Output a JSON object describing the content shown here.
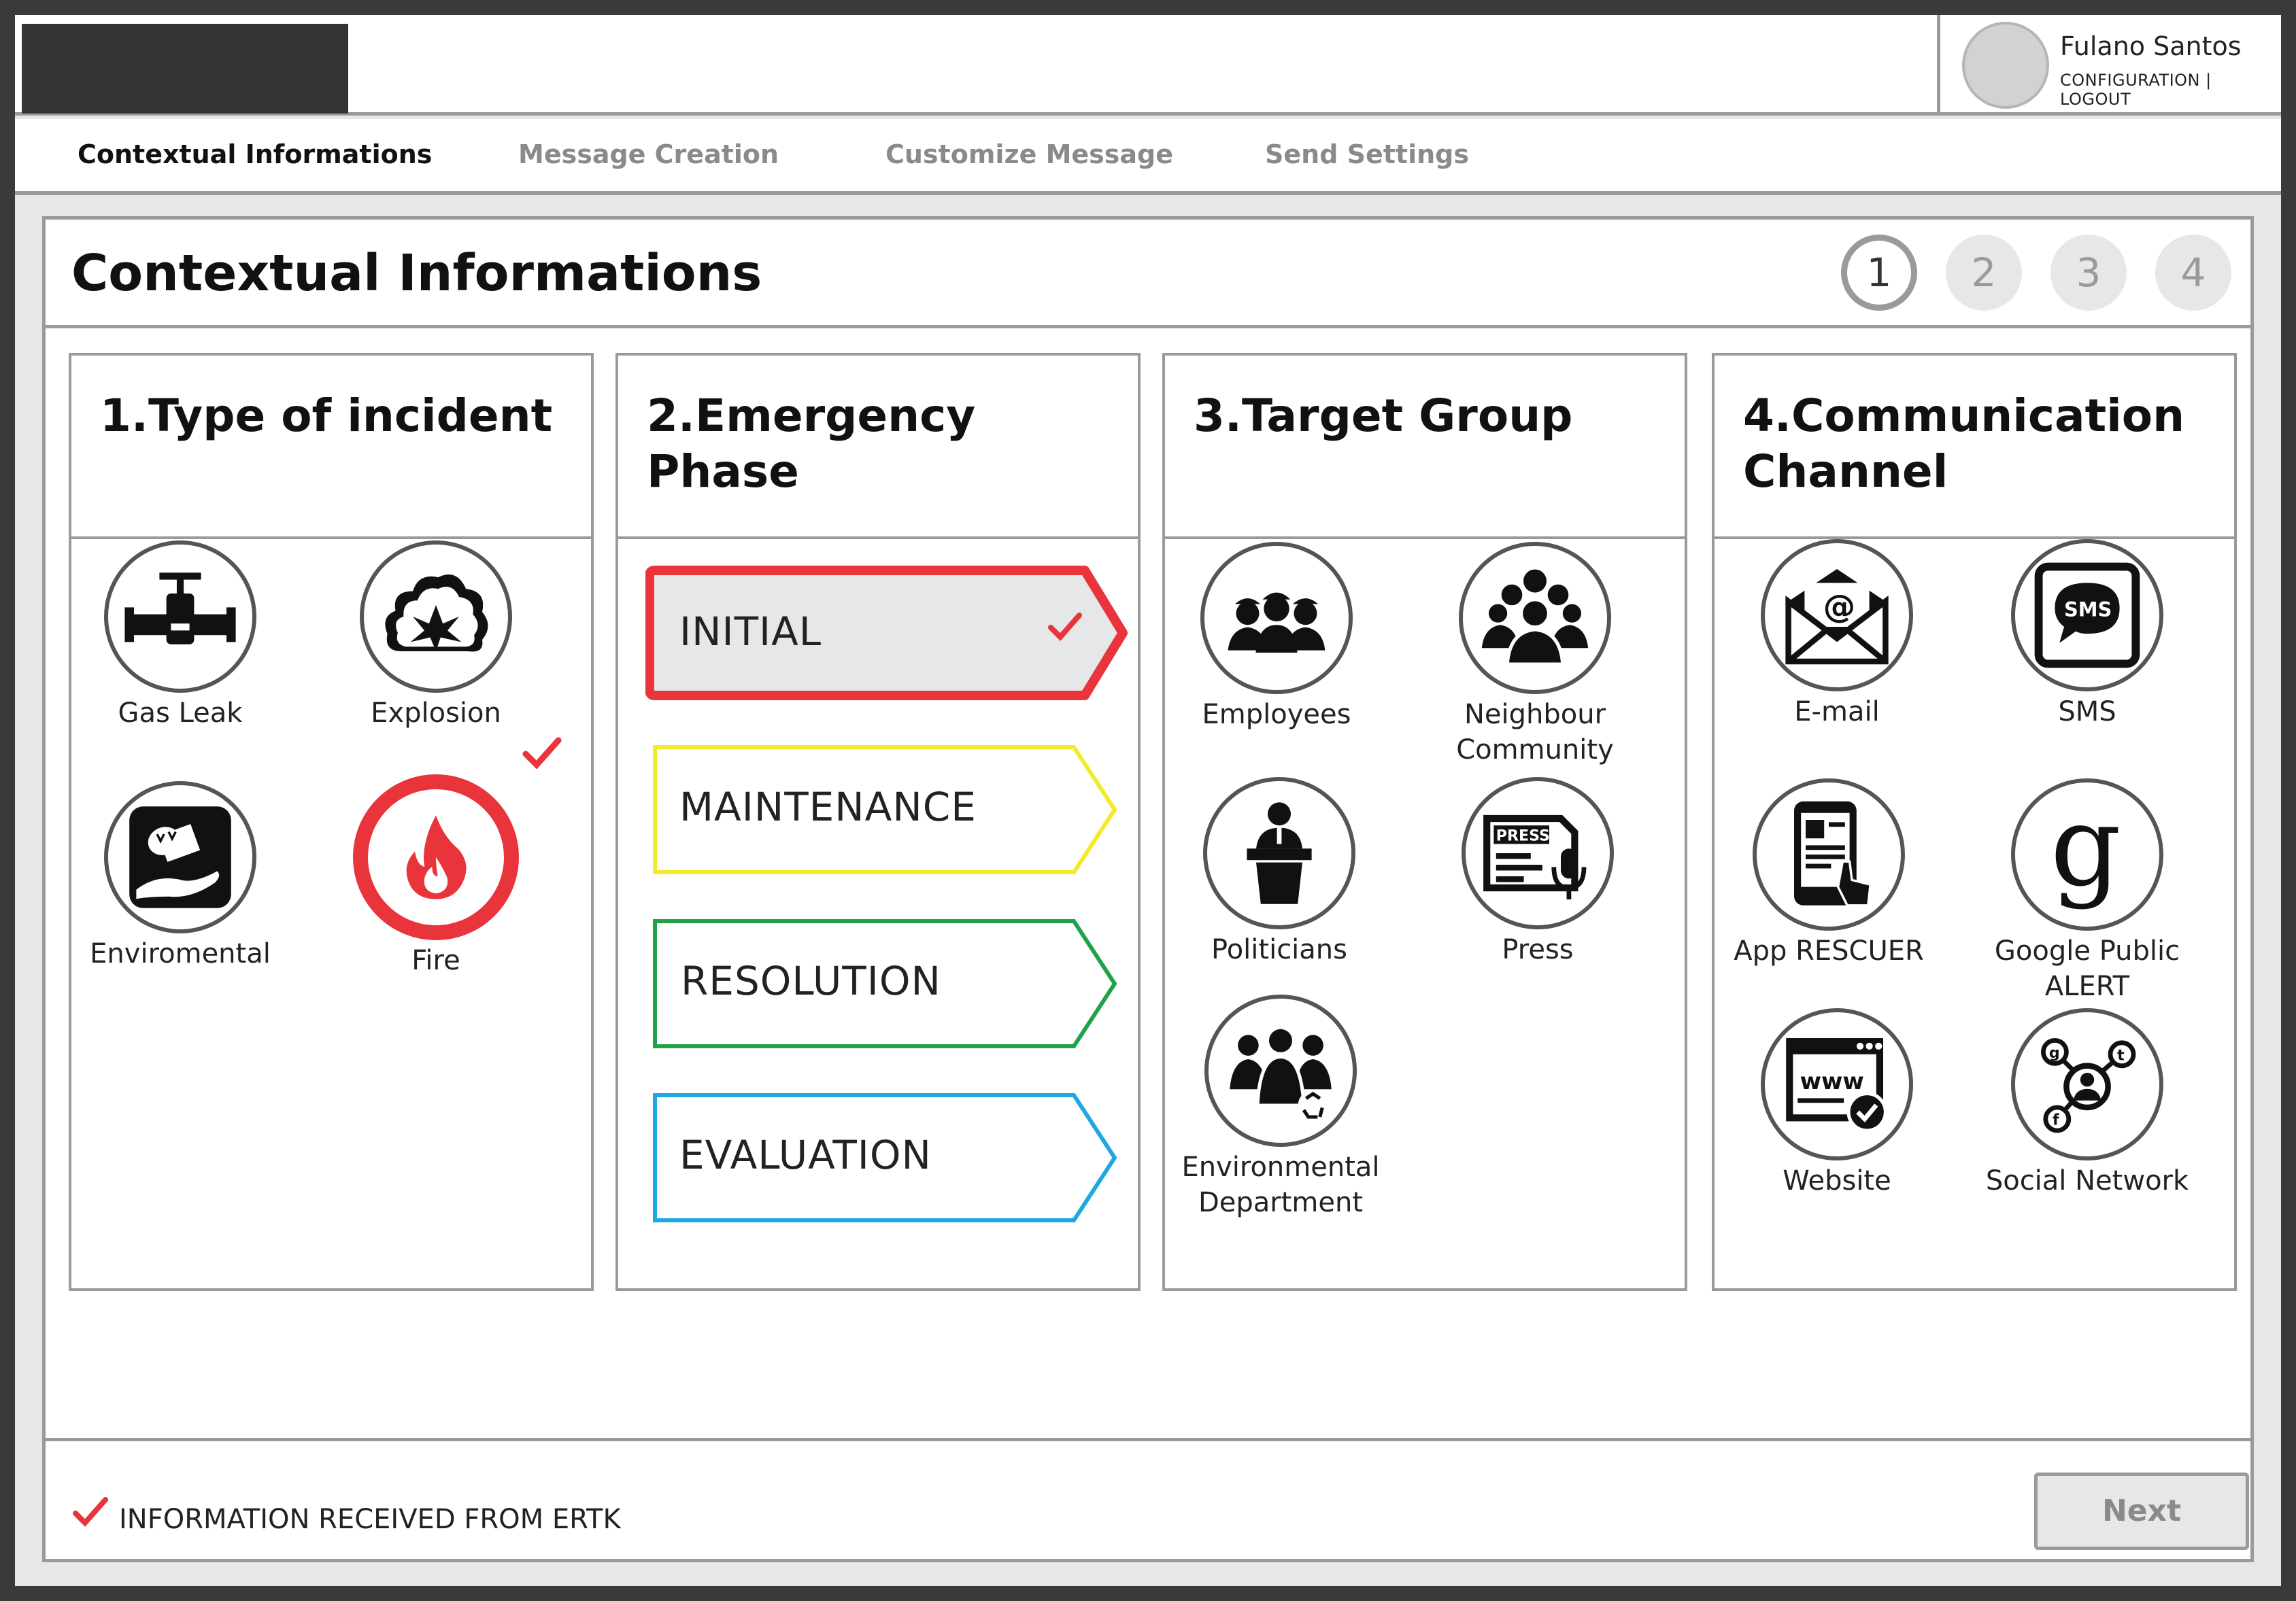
{
  "header": {
    "user_name": "Fulano Santos",
    "config_link": "CONFIGURATION",
    "separator": " | ",
    "logout_link": "LOGOUT"
  },
  "nav": {
    "tabs": [
      {
        "label": "Contextual Informations",
        "active": true
      },
      {
        "label": "Message Creation",
        "active": false
      },
      {
        "label": "Customize Message",
        "active": false
      },
      {
        "label": "Send Settings",
        "active": false
      }
    ]
  },
  "page": {
    "title": "Contextual Informations",
    "steps": [
      "1",
      "2",
      "3",
      "4"
    ],
    "active_step": "1"
  },
  "incident": {
    "title": "1.Type of incident",
    "options": [
      {
        "label": "Gas Leak",
        "icon": "gas-valve-icon",
        "selected": false
      },
      {
        "label": "Explosion",
        "icon": "explosion-icon",
        "selected": false
      },
      {
        "label": "Enviromental",
        "icon": "environmental-spill-icon",
        "selected": false
      },
      {
        "label": "Fire",
        "icon": "fire-icon",
        "selected": true
      }
    ]
  },
  "phase": {
    "title": "2.Emergency Phase",
    "options": [
      {
        "label": "INITIAL",
        "color": "#e8343a",
        "selected": true
      },
      {
        "label": "MAINTENANCE",
        "color": "#f2ea2a",
        "selected": false
      },
      {
        "label": "RESOLUTION",
        "color": "#1fa24a",
        "selected": false
      },
      {
        "label": "EVALUATION",
        "color": "#1fa7e1",
        "selected": false
      }
    ]
  },
  "target": {
    "title": "3.Target Group",
    "options": [
      {
        "label": "Employees",
        "icon": "workers-icon"
      },
      {
        "label": "Neighbour Community",
        "icon": "community-icon"
      },
      {
        "label": "Politicians",
        "icon": "politician-podium-icon"
      },
      {
        "label": "Press",
        "icon": "press-icon"
      },
      {
        "label": "Environmental Department",
        "icon": "environmental-department-icon"
      }
    ]
  },
  "channel": {
    "title": "4.Communication Channel",
    "options": [
      {
        "label": "E-mail",
        "icon": "email-icon"
      },
      {
        "label": "SMS",
        "icon": "sms-icon"
      },
      {
        "label": "App RESCUER",
        "icon": "app-phone-icon"
      },
      {
        "label": "Google Public ALERT",
        "icon": "google-icon"
      },
      {
        "label": "Website",
        "icon": "website-icon"
      },
      {
        "label": "Social Network",
        "icon": "social-network-icon"
      }
    ]
  },
  "footer": {
    "status_text": "INFORMATION RECEIVED FROM ERTK",
    "next_label": "Next"
  },
  "colors": {
    "accent_red": "#e8343a",
    "border_gray": "#9a9a9a",
    "icon_black": "#111111"
  }
}
